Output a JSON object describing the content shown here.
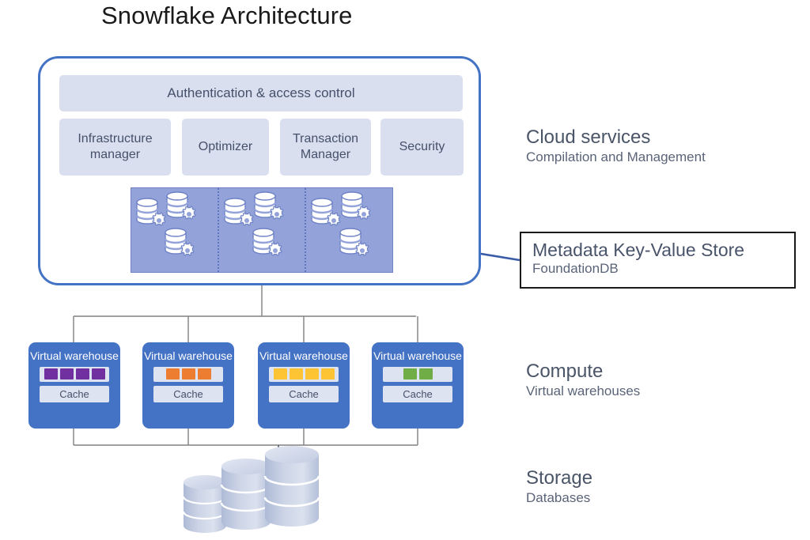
{
  "title": "Snowflake Architecture",
  "cloud_services": {
    "auth_card": "Authentication & access control",
    "cards": [
      {
        "label": "Infrastructure manager"
      },
      {
        "label": "Optimizer"
      },
      {
        "label": "Transaction Manager"
      },
      {
        "label": "Security"
      }
    ]
  },
  "metadata_panel": {
    "columns": 3,
    "icons_per_column": 3,
    "icon_name": "database-gear-icon",
    "panel_color": "#93a3da",
    "icon_color": "#ffffff"
  },
  "labels": {
    "cloud_services": {
      "title": "Cloud services",
      "subtitle": "Compilation and Management"
    },
    "compute": {
      "title": "Compute",
      "subtitle": "Virtual warehouses"
    },
    "storage": {
      "title": "Storage",
      "subtitle": "Databases"
    }
  },
  "callout": {
    "title": "Metadata Key-Value Store",
    "subtitle": "FoundationDB"
  },
  "compute": {
    "warehouses": [
      {
        "title": "Virtual warehouse",
        "cache_label": "Cache",
        "slot_count": 4,
        "slot_color": "#7030a0"
      },
      {
        "title": "Virtual warehouse",
        "cache_label": "Cache",
        "slot_count": 3,
        "slot_color": "#ed7d31"
      },
      {
        "title": "Virtual warehouse",
        "cache_label": "Cache",
        "slot_count": 4,
        "slot_color": "#ffc433"
      },
      {
        "title": "Virtual warehouse",
        "cache_label": "Cache",
        "slot_count": 2,
        "slot_color": "#70ad47"
      }
    ]
  },
  "storage": {
    "cylinder_groups": 3,
    "cylinder_color": "#c3cce2"
  },
  "colors": {
    "accent_blue": "#4472c4",
    "card_fill": "#d9dfef",
    "text_grey": "#4a5568",
    "connector_grey": "#808080"
  }
}
